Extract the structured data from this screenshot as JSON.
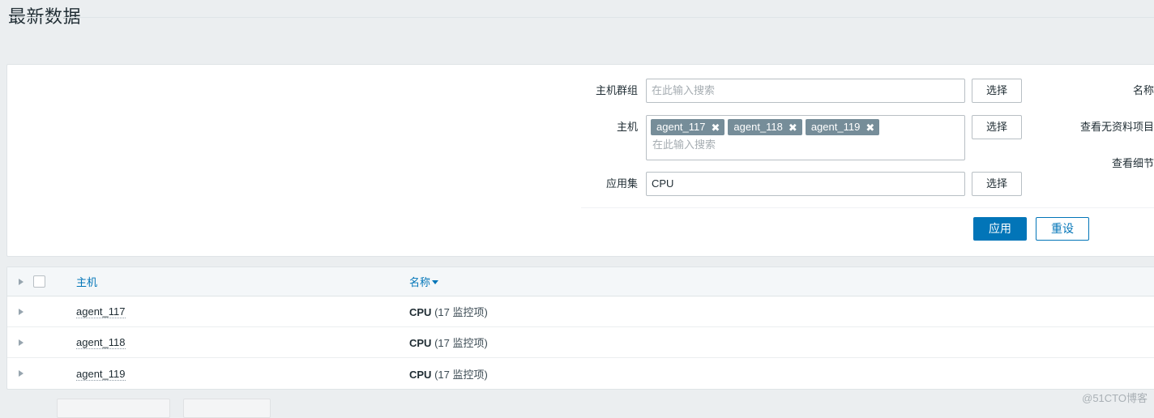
{
  "page": {
    "title": "最新数据",
    "watermark": "@51CTO博客"
  },
  "filter": {
    "rows": [
      {
        "label": "主机群组",
        "type": "search",
        "value": "",
        "placeholder": "在此输入搜索",
        "select_label": "选择"
      },
      {
        "label": "主机",
        "type": "multiselect",
        "chips": [
          "agent_117",
          "agent_118",
          "agent_119"
        ],
        "chip_remove": "✖",
        "placeholder": "在此输入搜索",
        "select_label": "选择"
      },
      {
        "label": "应用集",
        "type": "text",
        "value": "CPU",
        "placeholder": "",
        "select_label": "选择"
      }
    ],
    "right_labels": [
      "名称",
      "查看无资料项目",
      "查看细节"
    ],
    "apply_label": "应用",
    "reset_label": "重设"
  },
  "table": {
    "header": {
      "host": "主机",
      "name": "名称",
      "sort_dir": "desc"
    },
    "rows": [
      {
        "host": "agent_117",
        "app": "CPU",
        "count": "(17 监控项)"
      },
      {
        "host": "agent_118",
        "app": "CPU",
        "count": "(17 监控项)"
      },
      {
        "host": "agent_119",
        "app": "CPU",
        "count": "(17 监控项)"
      }
    ]
  },
  "colors": {
    "accent": "#0275b8",
    "chip": "#768d99",
    "page_bg": "#ebeef0"
  }
}
